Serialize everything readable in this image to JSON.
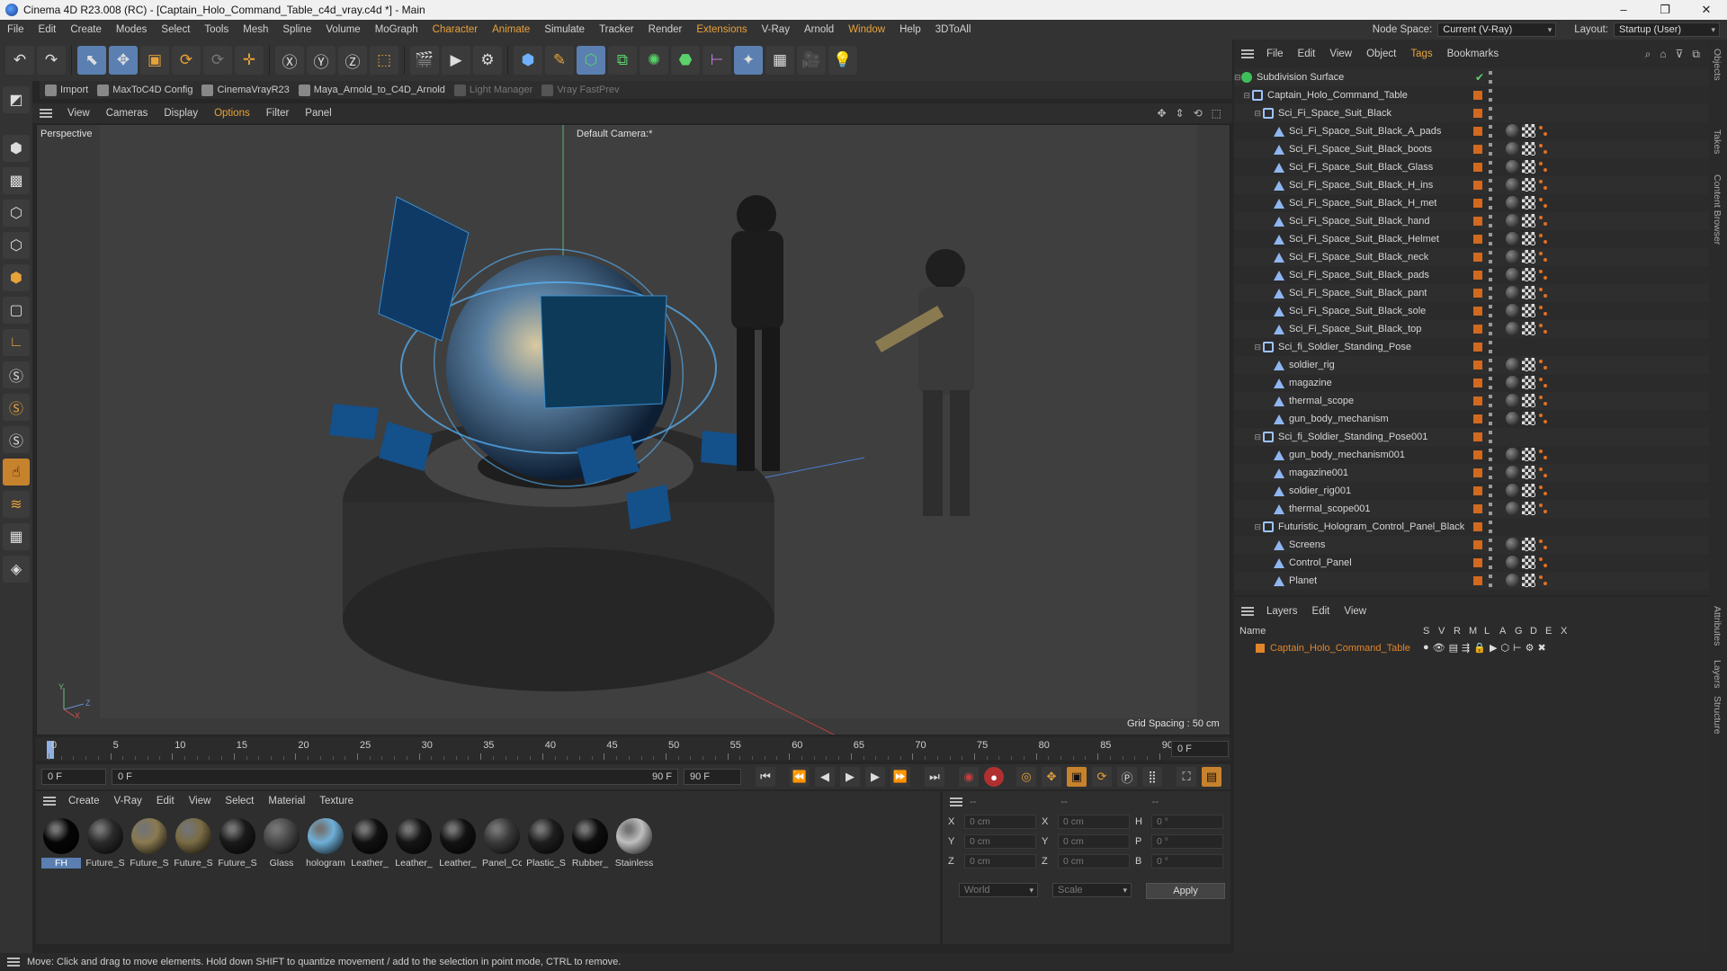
{
  "window": {
    "title": "Cinema 4D R23.008 (RC) - [Captain_Holo_Command_Table_c4d_vray.c4d *] - Main"
  },
  "menubar": {
    "items": [
      "File",
      "Edit",
      "Create",
      "Modes",
      "Select",
      "Tools",
      "Mesh",
      "Spline",
      "Volume",
      "MoGraph",
      "Character",
      "Animate",
      "Simulate",
      "Tracker",
      "Render",
      "Extensions",
      "V-Ray",
      "Arnold",
      "Window",
      "Help",
      "3DToAll"
    ],
    "node_space_label": "Node Space:",
    "node_space_value": "Current (V-Ray)",
    "layout_label": "Layout:",
    "layout_value": "Startup (User)"
  },
  "pluginbar": {
    "items": [
      "Import",
      "MaxToC4D Config",
      "CinemaVrayR23",
      "Maya_Arnold_to_C4D_Arnold",
      "Light Manager",
      "Vray FastPrev"
    ]
  },
  "viewport": {
    "menu": [
      "View",
      "Cameras",
      "Display",
      "Options",
      "Filter",
      "Panel"
    ],
    "view_name": "Perspective",
    "camera": "Default Camera",
    "camera_suffix": ":*",
    "grid_spacing": "Grid Spacing : 50 cm",
    "axis_y": "Y",
    "axis_z": "Z",
    "axis_x": "X"
  },
  "timeline": {
    "ticks": [
      "0",
      "5",
      "10",
      "15",
      "20",
      "25",
      "30",
      "35",
      "40",
      "45",
      "50",
      "55",
      "60",
      "65",
      "70",
      "75",
      "80",
      "85",
      "90"
    ],
    "end_field": "0 F"
  },
  "transport": {
    "current_frame": "0 F",
    "range_start": "0 F",
    "range_end": "90 F",
    "max_frame": "90 F"
  },
  "materials": {
    "menu": [
      "Create",
      "V-Ray",
      "Edit",
      "View",
      "Select",
      "Material",
      "Texture"
    ],
    "items": [
      {
        "name": "FH",
        "color": "#050505"
      },
      {
        "name": "Future_S",
        "color": "#2a2a2a"
      },
      {
        "name": "Future_S",
        "color": "#8a7a50"
      },
      {
        "name": "Future_S",
        "color": "#7a6c45"
      },
      {
        "name": "Future_S",
        "color": "#1a1a1a"
      },
      {
        "name": "Glass",
        "color": "#4a4a4a"
      },
      {
        "name": "hologram",
        "color": "#6fb0d8"
      },
      {
        "name": "Leather_",
        "color": "#111111"
      },
      {
        "name": "Leather_",
        "color": "#151515"
      },
      {
        "name": "Leather_",
        "color": "#121212"
      },
      {
        "name": "Panel_Cc",
        "color": "#3a3a3a"
      },
      {
        "name": "Plastic_S",
        "color": "#1e1e1e"
      },
      {
        "name": "Rubber_",
        "color": "#0e0e0e"
      },
      {
        "name": "Stainless",
        "color": "#bfbfbf"
      }
    ]
  },
  "coordinates": {
    "header_a": "--",
    "header_b": "--",
    "header_c": "--",
    "pos": [
      {
        "axis": "X",
        "value": "0 cm"
      },
      {
        "axis": "Y",
        "value": "0 cm"
      },
      {
        "axis": "Z",
        "value": "0 cm"
      }
    ],
    "size": [
      {
        "axis": "X",
        "value": "0 cm"
      },
      {
        "axis": "Y",
        "value": "0 cm"
      },
      {
        "axis": "Z",
        "value": "0 cm"
      }
    ],
    "rot": [
      {
        "axis": "H",
        "value": "0 °"
      },
      {
        "axis": "P",
        "value": "0 °"
      },
      {
        "axis": "B",
        "value": "0 °"
      }
    ],
    "mode_world": "World",
    "mode_scale": "Scale",
    "apply": "Apply"
  },
  "objects": {
    "menu": [
      "File",
      "Edit",
      "View",
      "Object",
      "Tags",
      "Bookmarks"
    ],
    "rows": [
      {
        "name": "Subdivision Surface",
        "depth": 0,
        "icon": "sds",
        "tags": "none"
      },
      {
        "name": "Captain_Holo_Command_Table",
        "depth": 1,
        "icon": "null",
        "tags": "none"
      },
      {
        "name": "Sci_Fi_Space_Suit_Black",
        "depth": 2,
        "icon": "null",
        "tags": "none"
      },
      {
        "name": "Sci_Fi_Space_Suit_Black_A_pads",
        "depth": 3,
        "icon": "poly",
        "tags": "full"
      },
      {
        "name": "Sci_Fi_Space_Suit_Black_boots",
        "depth": 3,
        "icon": "poly",
        "tags": "full"
      },
      {
        "name": "Sci_Fi_Space_Suit_Black_Glass",
        "depth": 3,
        "icon": "poly",
        "tags": "full"
      },
      {
        "name": "Sci_Fi_Space_Suit_Black_H_ins",
        "depth": 3,
        "icon": "poly",
        "tags": "full"
      },
      {
        "name": "Sci_Fi_Space_Suit_Black_H_met",
        "depth": 3,
        "icon": "poly",
        "tags": "full"
      },
      {
        "name": "Sci_Fi_Space_Suit_Black_hand",
        "depth": 3,
        "icon": "poly",
        "tags": "full"
      },
      {
        "name": "Sci_Fi_Space_Suit_Black_Helmet",
        "depth": 3,
        "icon": "poly",
        "tags": "full"
      },
      {
        "name": "Sci_Fi_Space_Suit_Black_neck",
        "depth": 3,
        "icon": "poly",
        "tags": "full"
      },
      {
        "name": "Sci_Fi_Space_Suit_Black_pads",
        "depth": 3,
        "icon": "poly",
        "tags": "full"
      },
      {
        "name": "Sci_Fi_Space_Suit_Black_pant",
        "depth": 3,
        "icon": "poly",
        "tags": "full"
      },
      {
        "name": "Sci_Fi_Space_Suit_Black_sole",
        "depth": 3,
        "icon": "poly",
        "tags": "full"
      },
      {
        "name": "Sci_Fi_Space_Suit_Black_top",
        "depth": 3,
        "icon": "poly",
        "tags": "full"
      },
      {
        "name": "Sci_fi_Soldier_Standing_Pose",
        "depth": 2,
        "icon": "null",
        "tags": "none"
      },
      {
        "name": "soldier_rig",
        "depth": 3,
        "icon": "poly",
        "tags": "full"
      },
      {
        "name": "magazine",
        "depth": 3,
        "icon": "poly",
        "tags": "full"
      },
      {
        "name": "thermal_scope",
        "depth": 3,
        "icon": "poly",
        "tags": "full"
      },
      {
        "name": "gun_body_mechanism",
        "depth": 3,
        "icon": "poly",
        "tags": "full"
      },
      {
        "name": "Sci_fi_Soldier_Standing_Pose001",
        "depth": 2,
        "icon": "null",
        "tags": "none"
      },
      {
        "name": "gun_body_mechanism001",
        "depth": 3,
        "icon": "poly",
        "tags": "full"
      },
      {
        "name": "magazine001",
        "depth": 3,
        "icon": "poly",
        "tags": "full"
      },
      {
        "name": "soldier_rig001",
        "depth": 3,
        "icon": "poly",
        "tags": "full"
      },
      {
        "name": "thermal_scope001",
        "depth": 3,
        "icon": "poly",
        "tags": "full"
      },
      {
        "name": "Futuristic_Hologram_Control_Panel_Black",
        "depth": 2,
        "icon": "null",
        "tags": "none"
      },
      {
        "name": "Screens",
        "depth": 3,
        "icon": "poly",
        "tags": "full"
      },
      {
        "name": "Control_Panel",
        "depth": 3,
        "icon": "poly",
        "tags": "full"
      },
      {
        "name": "Planet",
        "depth": 3,
        "icon": "poly",
        "tags": "full"
      }
    ]
  },
  "layers": {
    "menu": [
      "Layers",
      "Edit",
      "View"
    ],
    "name_col": "Name",
    "flag_cols": [
      "S",
      "V",
      "R",
      "M",
      "L",
      "A",
      "G",
      "D",
      "E",
      "X"
    ],
    "row_name": "Captain_Holo_Command_Table",
    "row_color": "#e0852a"
  },
  "right_tabs": [
    "Objects",
    "Takes",
    "Content Browser",
    "Attributes",
    "Layers",
    "Structure"
  ],
  "status": {
    "text": "Move: Click and drag to move elements. Hold down SHIFT to quantize movement / add to the selection in point mode, CTRL to remove."
  }
}
